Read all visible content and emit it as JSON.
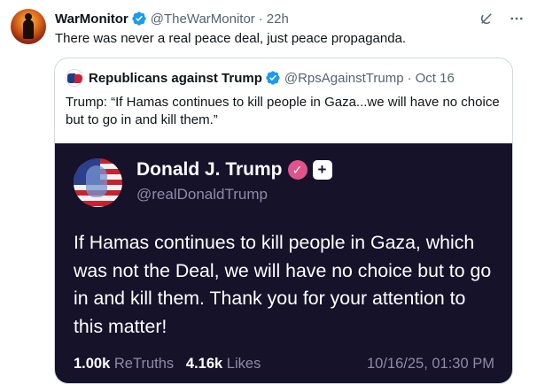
{
  "post": {
    "author_name": "WarMonitor",
    "author_handle": "@TheWarMonitor",
    "time": "22h",
    "text": "There was never a real peace deal, just peace propaganda."
  },
  "quote": {
    "author_name": "Republicans against Trump",
    "author_handle": "@RpsAgainstTrump",
    "date": "Oct 16",
    "text": "Trump: “If Hamas continues to kill people in Gaza...we will have no choice but to go in and kill them.”"
  },
  "truth": {
    "name": "Donald J. Trump",
    "handle": "@realDonaldTrump",
    "body": "If Hamas continues to kill people in Gaza, which was not the Deal, we will have no choice but to go in and kill them. Thank you for your attention to this matter!",
    "retruths_count": "1.00k",
    "retruths_label": "ReTruths",
    "likes_count": "4.16k",
    "likes_label": "Likes",
    "timestamp": "10/16/25, 01:30 PM"
  },
  "icons": {
    "verified": "verified-badge-icon",
    "grok": "grok-icon",
    "more": "more-icon",
    "truth_verified": "truth-verified-icon",
    "truth_plus": "plus-icon"
  },
  "colors": {
    "verified_blue": "#1d9bf0",
    "truth_bg": "#15122a",
    "truth_badge": "#e0538b",
    "secondary_text": "#536471"
  }
}
